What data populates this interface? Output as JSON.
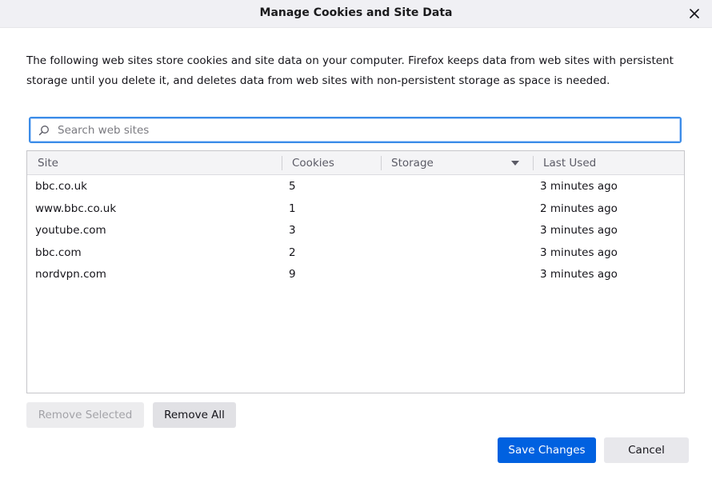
{
  "dialog": {
    "title": "Manage Cookies and Site Data",
    "close_icon": "close-icon"
  },
  "description": "The following web sites store cookies and site data on your computer. Firefox keeps data from web sites with persistent storage until you delete it, and deletes data from web sites with non-persistent storage as space is needed.",
  "search": {
    "placeholder": "Search web sites",
    "value": "",
    "icon": "search-icon",
    "focus_color": "#3b8ce8"
  },
  "table": {
    "columns": {
      "site": "Site",
      "cookies": "Cookies",
      "storage": "Storage",
      "last_used": "Last Used"
    },
    "sort_icon": "dropdown-arrow-icon",
    "rows": [
      {
        "site": "bbc.co.uk",
        "cookies": "5",
        "storage": "",
        "last_used": "3 minutes ago"
      },
      {
        "site": "www.bbc.co.uk",
        "cookies": "1",
        "storage": "",
        "last_used": "2 minutes ago"
      },
      {
        "site": "youtube.com",
        "cookies": "3",
        "storage": "",
        "last_used": "3 minutes ago"
      },
      {
        "site": "bbc.com",
        "cookies": "2",
        "storage": "",
        "last_used": "3 minutes ago"
      },
      {
        "site": "nordvpn.com",
        "cookies": "9",
        "storage": "",
        "last_used": "3 minutes ago"
      }
    ]
  },
  "buttons": {
    "remove_selected": "Remove Selected",
    "remove_all": "Remove All",
    "save_changes": "Save Changes",
    "cancel": "Cancel"
  },
  "colors": {
    "primary_button": "#0061e0",
    "titlebar": "#f0f0f4"
  }
}
